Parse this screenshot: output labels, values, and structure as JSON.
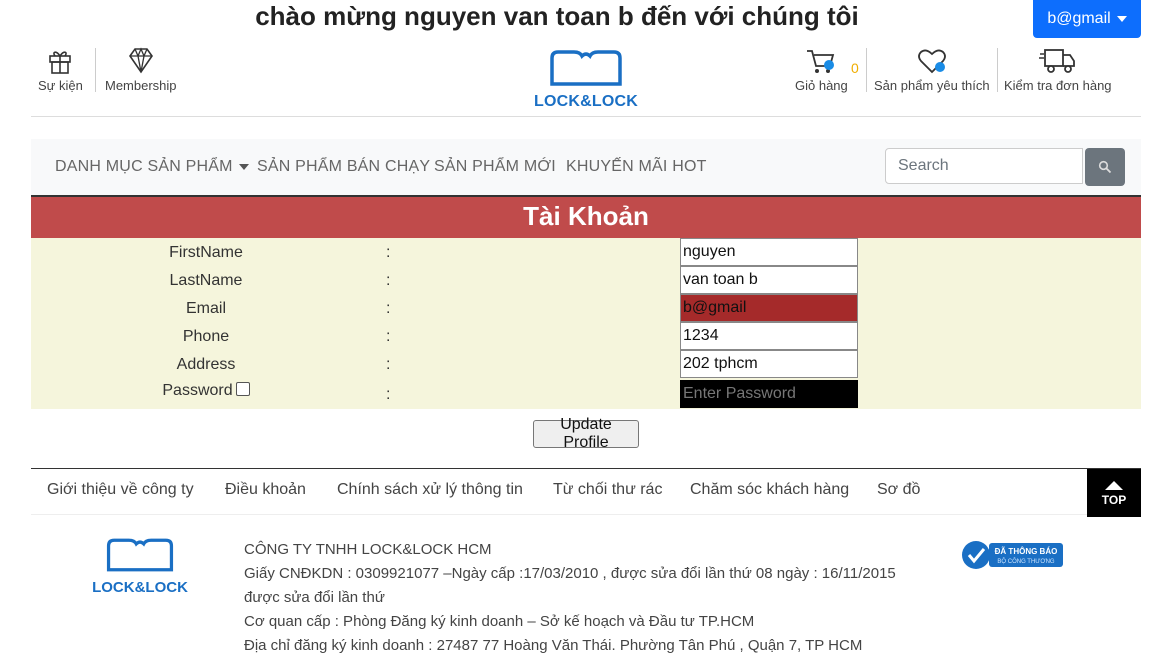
{
  "header": {
    "welcome": "chào mừng nguyen van toan b đến với chúng tôi",
    "user_menu": "b@gmail",
    "events_label": "Sự kiện",
    "membership_label": "Membership",
    "brand": "LOCK&LOCK",
    "cart_label": "Giỏ hàng",
    "cart_count": "0",
    "wishlist_label": "Sản phẩm yêu thích",
    "order_check_label": "Kiểm tra đơn hàng"
  },
  "nav": {
    "items": [
      "DANH MỤC SẢN PHẨM",
      "SẢN PHẨM BÁN CHẠY",
      "SẢN PHẨM MỚI",
      "KHUYẾN MÃI HOT"
    ],
    "search_placeholder": "Search"
  },
  "account": {
    "title": "Tài Khoản",
    "separator": ":",
    "fields": [
      {
        "label": "FirstName",
        "value": "nguyen"
      },
      {
        "label": "LastName",
        "value": "van toan b"
      },
      {
        "label": "Email",
        "value": "b@gmail"
      },
      {
        "label": "Phone",
        "value": "1234"
      },
      {
        "label": "Address",
        "value": "202 tphcm"
      },
      {
        "label": "Password",
        "placeholder": "Enter Password"
      }
    ],
    "update_button": "Update Profile"
  },
  "footer": {
    "links": [
      "Giới thiệu về công ty",
      "Điều khoản",
      "Chính sách xử lý thông tin",
      "Từ chối thư rác",
      "Chăm sóc khách hàng",
      "Sơ đồ"
    ],
    "top_label": "TOP",
    "brand": "LOCK&LOCK",
    "company_lines": [
      "CÔNG TY TNHH LOCK&LOCK HCM",
      "Giấy CNĐKDN : 0309921077 –Ngày cấp :17/03/2010 , được sửa đổi lần thứ 08 ngày : 16/11/2015",
      "được sửa đổi lần thứ",
      "Cơ quan cấp : Phòng Đăng ký kinh doanh – Sở kế hoạch và Đầu tư TP.HCM",
      "Địa chỉ đăng ký kinh doanh : 27487 77 Hoàng Văn Thái. Phường Tân Phú , Quận 7, TP HCM"
    ],
    "badge_title": "ĐÃ THÔNG BÁO",
    "badge_sub": "BỘ CÔNG THƯƠNG"
  },
  "colors": {
    "primary": "#0d6efd",
    "brand_blue": "#1a6fc4",
    "banner_red": "#c04b4b",
    "form_bg": "#f5f5dc",
    "email_field": "#a52a2a",
    "cart_badge": "#f0ad00"
  }
}
